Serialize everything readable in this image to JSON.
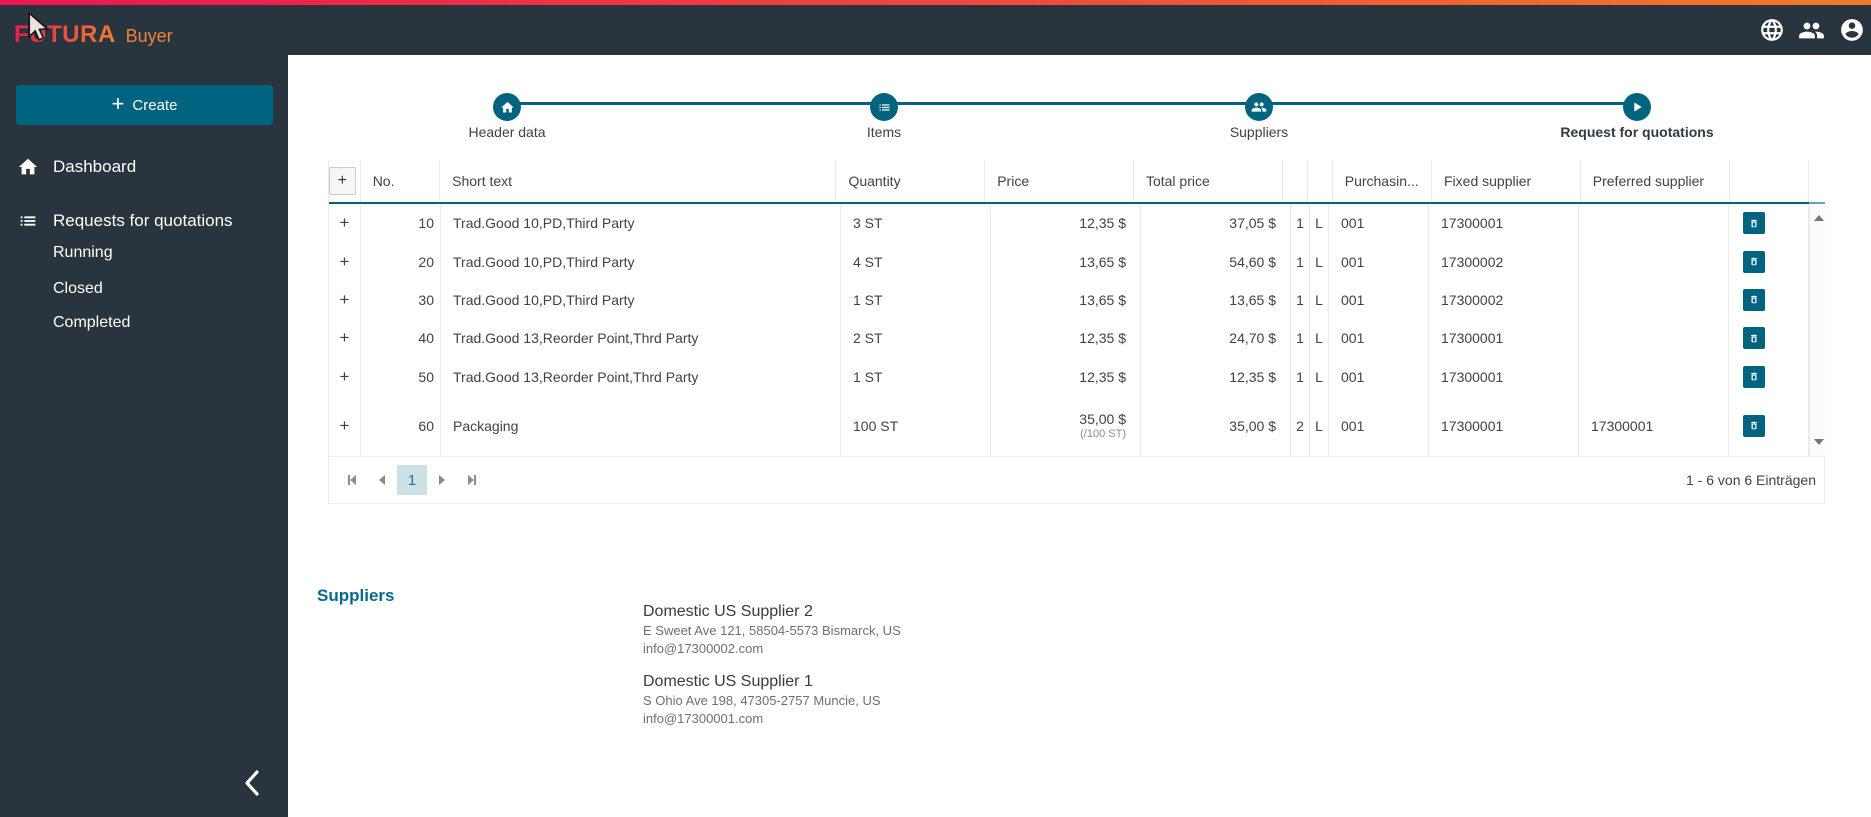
{
  "brand": {
    "name": "FUTURA",
    "product": "Buyer"
  },
  "sidebar": {
    "create_label": "Create",
    "items": [
      {
        "label": "Dashboard"
      },
      {
        "label": "Requests for quotations"
      }
    ],
    "subitems": [
      {
        "label": "Running"
      },
      {
        "label": "Closed"
      },
      {
        "label": "Completed"
      }
    ]
  },
  "stepper": {
    "steps": [
      {
        "label": "Header data",
        "icon": "home-icon",
        "active": false
      },
      {
        "label": "Items",
        "icon": "list-icon",
        "active": false
      },
      {
        "label": "Suppliers",
        "icon": "people-icon",
        "active": false
      },
      {
        "label": "Request for quotations",
        "icon": "play-icon",
        "active": true
      }
    ]
  },
  "table": {
    "expand_symbol": "+",
    "columns": [
      {
        "key": "exp",
        "label": ""
      },
      {
        "key": "no",
        "label": "No."
      },
      {
        "key": "text",
        "label": "Short text"
      },
      {
        "key": "qty",
        "label": "Quantity"
      },
      {
        "key": "price",
        "label": "Price"
      },
      {
        "key": "total",
        "label": "Total price"
      },
      {
        "key": "c1",
        "label": ""
      },
      {
        "key": "c2",
        "label": ""
      },
      {
        "key": "purch",
        "label": "Purchasin..."
      },
      {
        "key": "fixed",
        "label": "Fixed supplier"
      },
      {
        "key": "pref",
        "label": "Preferred supplier"
      },
      {
        "key": "actions",
        "label": ""
      }
    ],
    "rows": [
      {
        "no": "10",
        "text": "Trad.Good 10,PD,Third Party",
        "qty": "3 ST",
        "price": "12,35 $",
        "total": "37,05 $",
        "c1": "1",
        "c2": "L",
        "purch": "001",
        "fixed": "17300001",
        "pref": ""
      },
      {
        "no": "20",
        "text": "Trad.Good 10,PD,Third Party",
        "qty": "4 ST",
        "price": "13,65 $",
        "total": "54,60 $",
        "c1": "1",
        "c2": "L",
        "purch": "001",
        "fixed": "17300002",
        "pref": ""
      },
      {
        "no": "30",
        "text": "Trad.Good 10,PD,Third Party",
        "qty": "1 ST",
        "price": "13,65 $",
        "total": "13,65 $",
        "c1": "1",
        "c2": "L",
        "purch": "001",
        "fixed": "17300002",
        "pref": ""
      },
      {
        "no": "40",
        "text": "Trad.Good 13,Reorder Point,Thrd Party",
        "qty": "2 ST",
        "price": "12,35 $",
        "total": "24,70 $",
        "c1": "1",
        "c2": "L",
        "purch": "001",
        "fixed": "17300001",
        "pref": ""
      },
      {
        "no": "50",
        "text": "Trad.Good 13,Reorder Point,Thrd Party",
        "qty": "1 ST",
        "price": "12,35 $",
        "total": "12,35 $",
        "c1": "1",
        "c2": "L",
        "purch": "001",
        "fixed": "17300001",
        "pref": ""
      },
      {
        "no": "60",
        "text": "Packaging",
        "qty": "100 ST",
        "price": "35,00 $",
        "price_unit": "(/100 ST)",
        "total": "35,00 $",
        "c1": "2",
        "c2": "L",
        "purch": "001",
        "fixed": "17300001",
        "pref": "17300001"
      }
    ]
  },
  "pager": {
    "page": "1",
    "summary": "1 - 6 von 6 Einträgen"
  },
  "suppliers_section": {
    "title": "Suppliers",
    "suppliers": [
      {
        "name": "Domestic US Supplier 2",
        "address": "E Sweet Ave 121, 58504-5573 Bismarck, US",
        "email": "info@17300002.com"
      },
      {
        "name": "Domestic US Supplier 1",
        "address": "S Ohio Ave 198, 47305-2757 Muncie, US",
        "email": "info@17300001.com"
      }
    ]
  },
  "colors": {
    "primary": "#006480",
    "brand_gradient_start": "#ec1651",
    "brand_gradient_end": "#f17b28",
    "dark": "#28343e"
  }
}
